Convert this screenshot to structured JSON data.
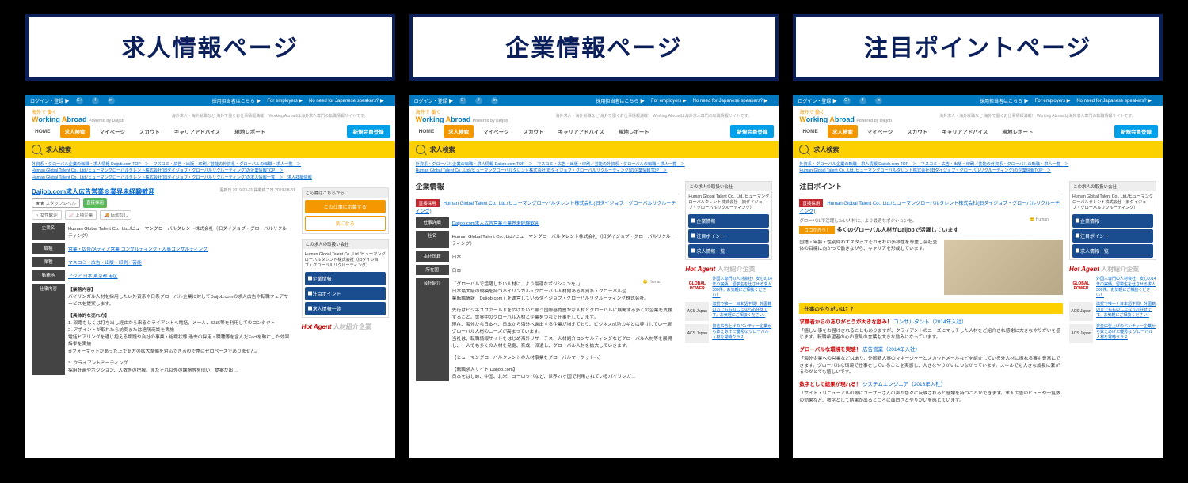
{
  "titles": [
    "求人情報ページ",
    "企業情報ページ",
    "注目ポイントページ"
  ],
  "topbar": {
    "login": "ログイン・登録 ▶",
    "emp_jp": "採用担当者はこちら ▶",
    "emp_en": "For employers ▶",
    "noneed": "No need for Japanese speakers? ▶"
  },
  "logo": {
    "pre": "海外で 働く",
    "main": "Working Abroad",
    "by": "Powered by Daijob"
  },
  "logoside": "海外求人・海外就職など 海外で働くお仕事情報満載！ Working Abroadは海外求人専門の転職情報サイトです。",
  "nav": {
    "items": [
      "HOME",
      "求人検索",
      "マイページ",
      "スカウト",
      "キャリアアドバイス",
      "現地レポート"
    ],
    "reg": "新規会員登録"
  },
  "search_label": "求人検索",
  "crumbs": [
    "外資系・グローバル企業の転職・求人情報 Daijob.com TOP　＞　マスコミ・広告・出版・印刷／芸能の外資系・グローバルの転職・求人一覧　＞",
    "Human Global Talent Co., Ltd./ヒューマングローバルタレント株式会社(旧ダイジョブ・グローバルリクルーティング)の企業情報TOP　＞",
    "Human Global Talent Co., Ltd./ヒューマングローバルタレント株式会社(旧ダイジョブ・グローバルリクルーティング)の求人情報一覧　＞　求人詳細情報"
  ],
  "p1": {
    "job_title": "Daijob.com求人広告営業※業界未経験歓迎",
    "dates": "更新日 2019-03-01 掲載終了日 2019-08-31",
    "badges": {
      "star": "★★ スタッフレベル",
      "direct": "直接採用",
      "b1": "女性歓迎",
      "b2": "上場企業",
      "b3": "転勤なし"
    },
    "rows": {
      "company_l": "企業名",
      "company_v": "Human Global Talent Co., Ltd./ヒューマングローバルタレント株式会社（旧ダイジョブ・グローバルリクルーティング）",
      "occ_l": "職種",
      "occ_v": "営業・広告/メディア営業 コンサルティング・人事コンサルティング",
      "ind_l": "業種",
      "ind_v": "マスコミ・広告・出版・印刷／芸能",
      "loc_l": "勤務地",
      "loc_v": "アジア 日本 東京都 港区",
      "job_l": "仕事内容",
      "job_v_h": "【業務内容】",
      "job_v1": "バイリンガル人材を採用したい外資系や日系グローバル企業に対してDaijob.comの求人広告や転職フェアサービスを提案します。",
      "job_v_h2": "【具体的な売れ方】",
      "job_v2": "1. 架電もしくは打ち出し経由から来るクライアントへ電話、メール、SNS等を利用してのコンタクト",
      "job_v3": "2. アポイントが取れたら訪問または遠隔商談を実施",
      "job_v4": "電話ヒアリングを通じ抱える課題や会社の事業・組織状態 過去の採用・職種等を含んだFactを軸にした効果訴求を実施",
      "job_v5": "※フォーマットがあった上で此方の拡大準備を対応できるので常にゼロベースでありません。",
      "job_v6": "3. クライアントミーティング",
      "job_v7": "採用計画やポジション、人数等の把握。またそれ以外の課題等を伺い、提案が出…"
    },
    "side": {
      "hd1": "ご応募はこちらから",
      "apply": "この仕事に応募する",
      "fav": "気になる",
      "hd2": "この求人の取扱い会社",
      "cname": "Human Global Talent Co., Ltd./ヒューマングローバルタレント株式会社（旧ダイジョブ・グローバルリクルーティング）",
      "b1": "企業情報",
      "b2": "注目ポイント",
      "b3": "求人情報一覧",
      "hot": "Hot Agent",
      "hot2": "人材紹介企業"
    }
  },
  "p2": {
    "sec": "企業情報",
    "direct": {
      "tag": "直接採用",
      "name": "Human Global Talent Co., Ltd./ヒューマングローバルタレント株式会社(旧ダイジョブ・グローバルリクルーティング)"
    },
    "rows": {
      "job_l": "仕事詳細",
      "job_v": "Daijob.com求人広告営業※業界未経験歓迎",
      "name_l": "社名",
      "name_v": "Human Global Talent Co., Ltd./ヒューマングローバルタレント株式会社（旧ダイジョブ・グローバルリクルーティング）",
      "hq_l": "本社国籍",
      "hq_v": "日本",
      "br_l": "所在国",
      "br_v": "日本",
      "intro_l": "会社紹介",
      "intro1": "「グローバルで活躍したい人材に、より最適なポジションを。」",
      "intro2": "日本最大級の規模を持つバイリンガル・グローバル人材向ある外資系・グローバル企業転職情報「Daijob.com」を運営しているダイジョブ・グローバルリクルーティング株式会社。",
      "intro3": "先行はビジネスファールドを広げたいと願う国際感覚豊かな人材とグローバルに展開する多くの企業を支援すること。世界中のグローバル人材と企業をつなぐ仕事をしています。",
      "intro4": "現在、海外から日本へ、日本から海外へ進出する企業が増えており、ビジネス成功カギとは弊けしてい一層グローバル人材のニーズが高まっています。",
      "intro5": "当社は、転職情報サイトをはじめ海外リサーチス、人材紹介コンサルティングなどグローバル人材等を展開し、一人でも多くの人材を発掘、育成、派遣し、グローバル人材を拡大していきます。",
      "intro6": "【ヒューマングローバルタレントの人材事業をグローバルマーケットへ】",
      "intro7": "【転職求人サイト Daijob.com】",
      "intro8": "日本をはじめ、中国、北米、ヨーロッパなど、世界27ヶ国で利用されているバイリンガ…"
    },
    "side": {
      "hd": "この求人の取扱い会社",
      "cname": "Human Global Talent Co., Ltd./ヒューマングローバルタレント株式会社（旧ダイジョブ・グローバルリクルーティング）",
      "b1": "企業情報",
      "b2": "注目ポイント",
      "b3": "求人情報一覧",
      "hot": "Hot Agent",
      "hot2": "人材紹介企業",
      "h1_logo": "GLOBAL POWER",
      "h1": "外国人専門の人材会社！安心の14年の実績。留学生を仕させる求人300件。お気軽にご相談ください！",
      "h2_logo": "ACS Japan",
      "h2": "滋賀で唯一！日本語不問！外国籍の方でもものしたならお任せです。お気軽にご相談ください♪",
      "h3_logo": "ACS Japan",
      "h3": "資金広告上げのベンチャー企業から数えあげた優秀な グローバル人材を常時クラス"
    }
  },
  "p3": {
    "sec": "注目ポイント",
    "direct": {
      "tag": "直接採用",
      "name": "Human Global Talent Co., Ltd./ヒューマングローバルタレント株式会社(旧ダイジョブ・グローバルリクルーティング)"
    },
    "bar": {
      "tag": "ココが売り！",
      "txt": "多くのグローバル人材がDaijobで活躍しています"
    },
    "para1": "国籍・年齢・性別問わずスタッフそれぞれの多様性を尊重し会社全体の目標に向かって働きながら、キャリアを形成しています。",
    "sub1": "仕事のやりがいは？？",
    "r1h": "求職者からのありがとうが大きな励み！",
    "r1s": "コンサルタント（2014年入社）",
    "r1p": "「嬉しい事をお届けされることもありますが、クライアントのニーズにマッチした人材をご紹介され感謝に大きなやりがいを感じます。転職希望者の心の意見の言葉も大きな励みになっています。",
    "r2h": "グローバルな環境を実感！",
    "r2s": "広告営業（2014年入社）",
    "r2p": "「海外企業への営業などはあり、外国籍人事のマネージャーとスカウトメールなどを紹介している外人材に振れる事も豊富にできます。グローバルな環境で仕事をしていることを実感し、大きなやりがいにつながっています。スキルでも大きな成長に繋がるのがとても嬉しいです。",
    "r3h": "数字として結果が現れる！",
    "r3s": "システムエンジニア（2013年入社）",
    "r3p": "「サイト・リニューアルの際にユーザーさんの声が色々に反映されると感謝を持つことができます。求人広告のビューや一覧数の効果など、数字として結果が出るところに面白さとやりがいを感じています。"
  }
}
